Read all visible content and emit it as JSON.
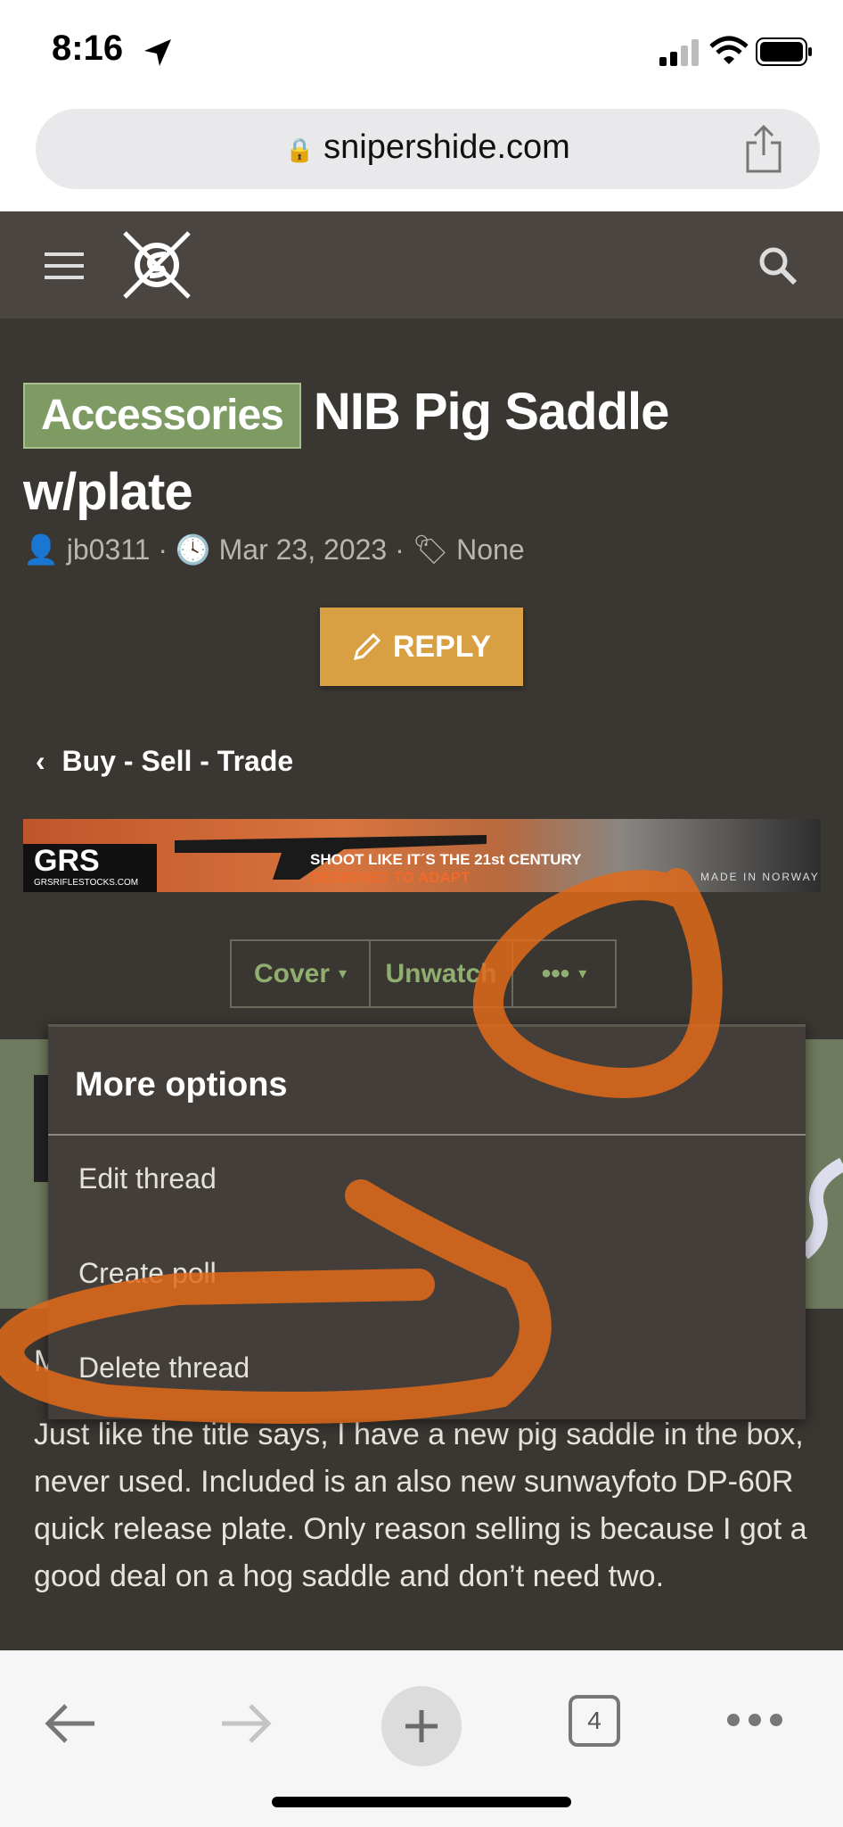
{
  "status_bar": {
    "time": "8:16"
  },
  "browser": {
    "url": "snipershide.com",
    "tab_count": "4"
  },
  "thread": {
    "prefix": "Accessories",
    "title": "NIB Pig Saddle w/plate",
    "author": "jb0311",
    "date": "Mar 23, 2023",
    "tags": "None",
    "reply_label": "REPLY",
    "breadcrumb": "Buy - Sell - Trade"
  },
  "banner": {
    "brand": "GRS",
    "site": "GRSRIFLESTOCKS.COM",
    "tagline": "SHOOT LIKE IT´S THE 21st CENTURY",
    "subtagline": "DESIGNED TO ADAPT",
    "origin": "MADE IN NORWAY"
  },
  "thread_buttons": {
    "cover": "Cover",
    "unwatch": "Unwatch",
    "more": "•••"
  },
  "more_menu": {
    "header": "More options",
    "items": [
      "Edit thread",
      "Create poll",
      "Delete thread"
    ]
  },
  "post": {
    "body": "Just like the title says, I have a new pig saddle in the box, never used. Included is an also new sunwayfoto DP-60R quick release plate. Only reason selling is because I got a good deal on a hog saddle and don’t need two.",
    "clipped_initial": "M"
  },
  "colors": {
    "header_bg": "#4a4540",
    "content_bg": "#3a3632",
    "badge_green": "#7e9b63",
    "reply_gold": "#d8a043",
    "link_green": "#8fae6f",
    "annotation_orange": "#e06a1a"
  }
}
